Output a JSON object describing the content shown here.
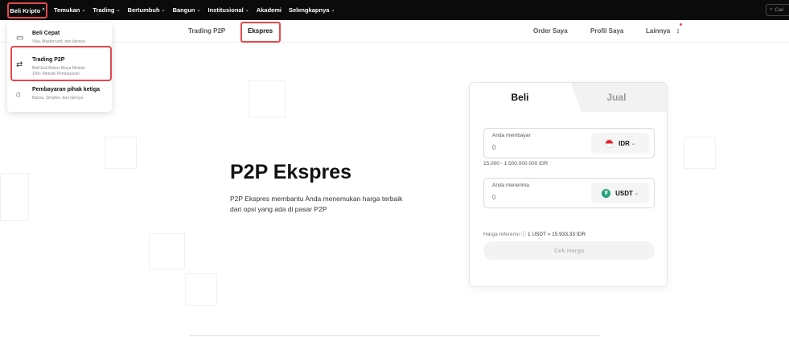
{
  "topnav": {
    "first": {
      "label": "Beli Kripto"
    },
    "items": [
      {
        "label": "Temukan"
      },
      {
        "label": "Trading"
      },
      {
        "label": "Bertumbuh"
      },
      {
        "label": "Bangun"
      },
      {
        "label": "Institusional"
      },
      {
        "label": "Akademi"
      },
      {
        "label": "Selengkapnya"
      }
    ],
    "search_placeholder": "Cari"
  },
  "subnav": {
    "tabs": [
      {
        "label": "Trading P2P"
      },
      {
        "label": "Ekspres"
      }
    ],
    "right": [
      {
        "label": "Order Saya"
      },
      {
        "label": "Profil Saya"
      },
      {
        "label": "Lainnya"
      }
    ]
  },
  "dropdown": {
    "items": [
      {
        "title": "Beli Cepat",
        "sub": "Visa, Mastercard, dan lainnya",
        "sub2": ""
      },
      {
        "title": "Trading P2P",
        "sub": "Beli/Jual Bebas Biaya Melalui",
        "sub2": "100+ Metode Pembayaran"
      },
      {
        "title": "Pembayaran pihak ketiga",
        "sub": "Banxa, Simplex, dan lainnya",
        "sub2": ""
      }
    ]
  },
  "hero": {
    "title": "P2P Ekspres",
    "desc_line1": "P2P Ekspres membantu Anda menemukan harga terbaik",
    "desc_line2": "dari opsi yang ada di pasar P2P"
  },
  "card": {
    "tab_buy": "Beli",
    "tab_sell": "Jual",
    "pay": {
      "label": "Anda membayar",
      "placeholder": "0",
      "currency": "IDR"
    },
    "range": "15.000 - 1.500.000.000 IDR",
    "receive": {
      "label": "Anda menerima",
      "placeholder": "0",
      "currency": "USDT"
    },
    "ref_label": "Harga referensi",
    "ref_value": "1 USDT ≈ 15.933,33 IDR",
    "check_button": "Cek Harga"
  },
  "colors": {
    "accent_red": "#e5484d",
    "usdt_green": "#26a17b",
    "nav_bg": "#0b0b0b"
  }
}
